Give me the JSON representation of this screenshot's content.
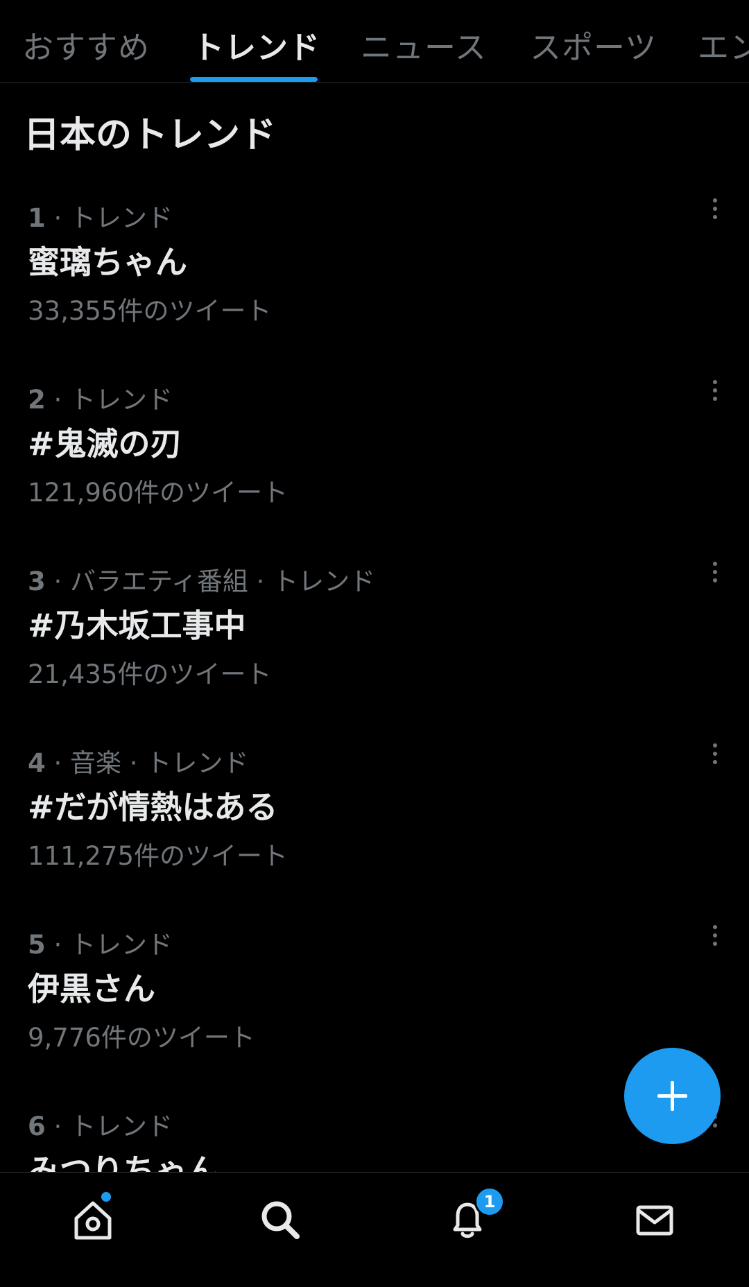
{
  "tabs": [
    {
      "label": "おすすめ",
      "active": false
    },
    {
      "label": "トレンド",
      "active": true
    },
    {
      "label": "ニュース",
      "active": false
    },
    {
      "label": "スポーツ",
      "active": false
    },
    {
      "label": "エン",
      "active": false
    }
  ],
  "section_title": "日本のトレンド",
  "trends": [
    {
      "rank": "1",
      "meta": " · トレンド",
      "name": "蜜璃ちゃん",
      "count": "33,355件のツイート"
    },
    {
      "rank": "2",
      "meta": " · トレンド",
      "name": "#鬼滅の刃",
      "count": "121,960件のツイート"
    },
    {
      "rank": "3",
      "meta": " · バラエティ番組 · トレンド",
      "name": "#乃木坂工事中",
      "count": "21,435件のツイート"
    },
    {
      "rank": "4",
      "meta": " · 音楽 · トレンド",
      "name": "#だが情熱はある",
      "count": "111,275件のツイート"
    },
    {
      "rank": "5",
      "meta": " · トレンド",
      "name": "伊黒さん",
      "count": "9,776件のツイート"
    },
    {
      "rank": "6",
      "meta": " · トレンド",
      "name": "みつりちゃん",
      "count": ""
    }
  ],
  "fab": {
    "icon": "plus-icon"
  },
  "bottom_nav": {
    "items": [
      {
        "name": "home",
        "icon": "home-icon",
        "has_dot": true
      },
      {
        "name": "search",
        "icon": "search-icon"
      },
      {
        "name": "notifications",
        "icon": "bell-icon",
        "badge": "1"
      },
      {
        "name": "messages",
        "icon": "mail-icon"
      }
    ]
  },
  "colors": {
    "accent": "#1d9bf0",
    "background": "#000000",
    "secondary_text": "#71767b"
  }
}
